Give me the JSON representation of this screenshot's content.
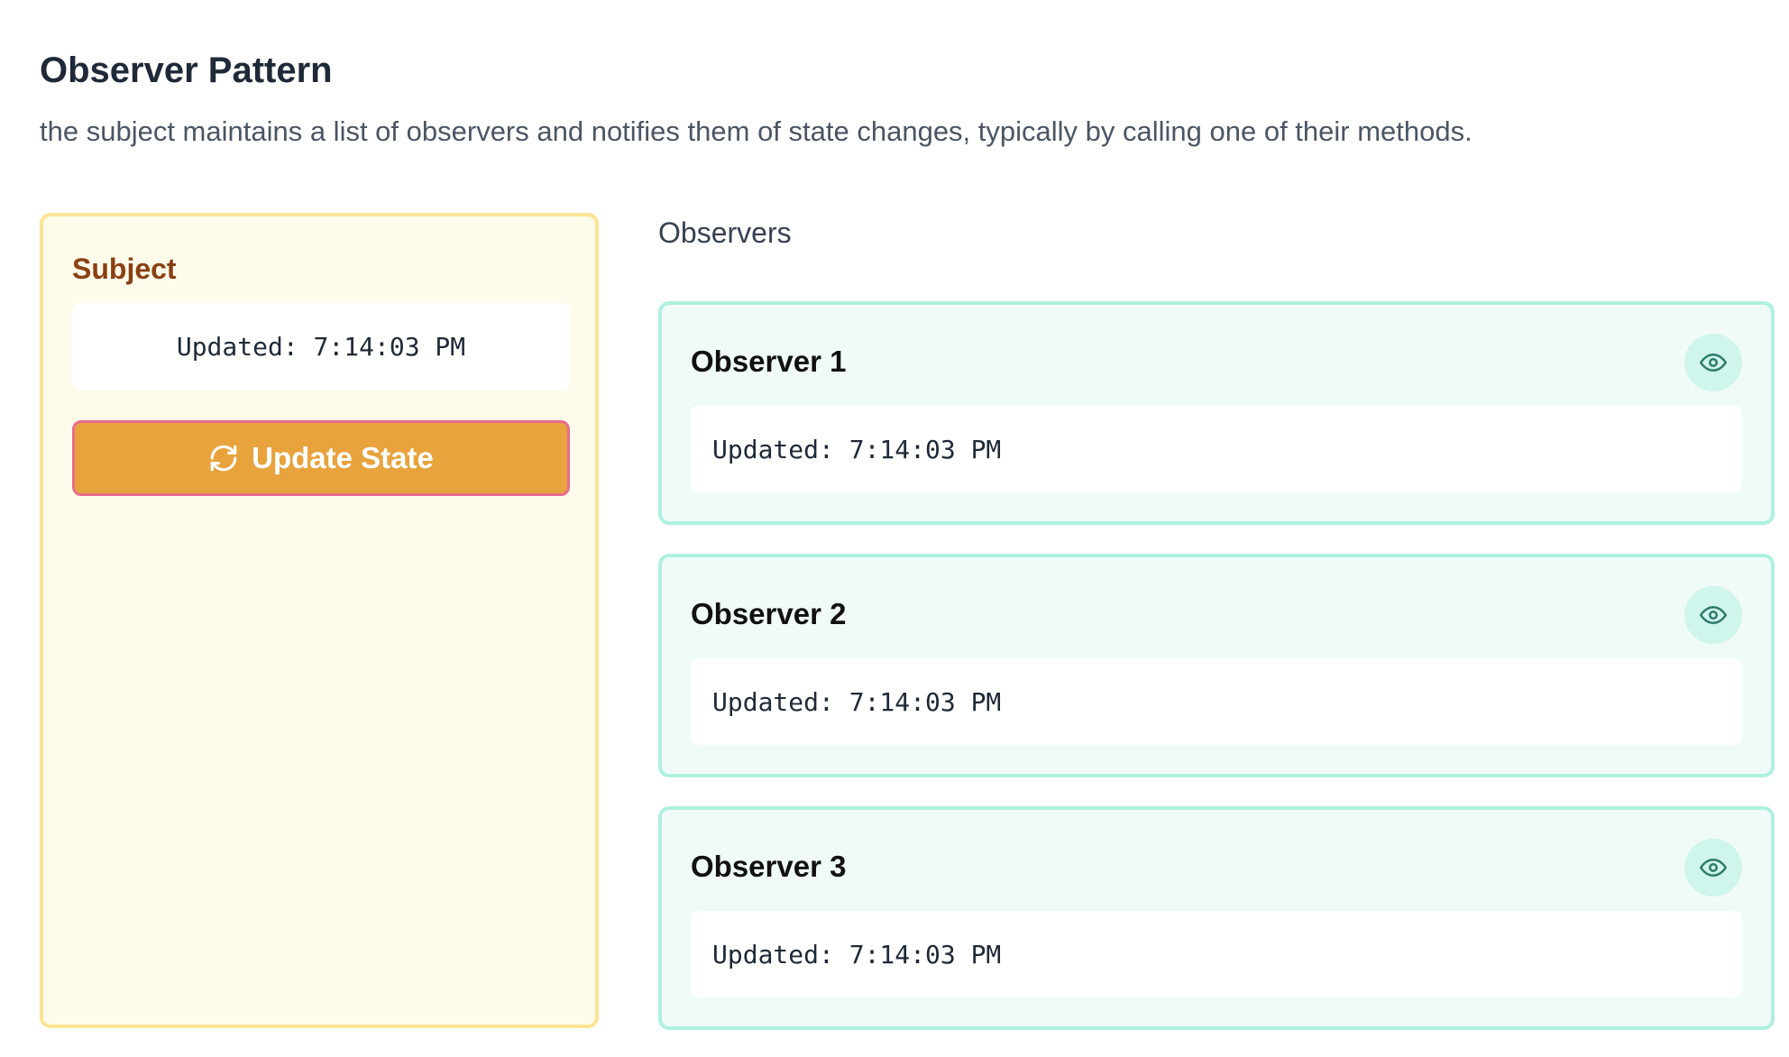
{
  "header": {
    "title": "Observer Pattern",
    "description": "the subject maintains a list of observers and notifies them of state changes, typically by calling one of their methods."
  },
  "subject": {
    "title": "Subject",
    "state": "Updated: 7:14:03 PM",
    "button_label": "Update State",
    "button_icon": "refresh-icon"
  },
  "observers": {
    "title": "Observers",
    "items": [
      {
        "name": "Observer 1",
        "state": "Updated: 7:14:03 PM",
        "icon": "eye-icon"
      },
      {
        "name": "Observer 2",
        "state": "Updated: 7:14:03 PM",
        "icon": "eye-icon"
      },
      {
        "name": "Observer 3",
        "state": "Updated: 7:14:03 PM",
        "icon": "eye-icon"
      }
    ]
  },
  "colors": {
    "subject_bg": "#fefbea",
    "subject_border": "#fae494",
    "subject_title": "#8a4012",
    "button_bg": "#e8a33c",
    "button_border": "#e86c8e",
    "observer_bg": "#f0fbf8",
    "observer_border": "#aff0e0",
    "eye_bg": "#cff5ec",
    "eye_stroke": "#2f7a6b"
  }
}
